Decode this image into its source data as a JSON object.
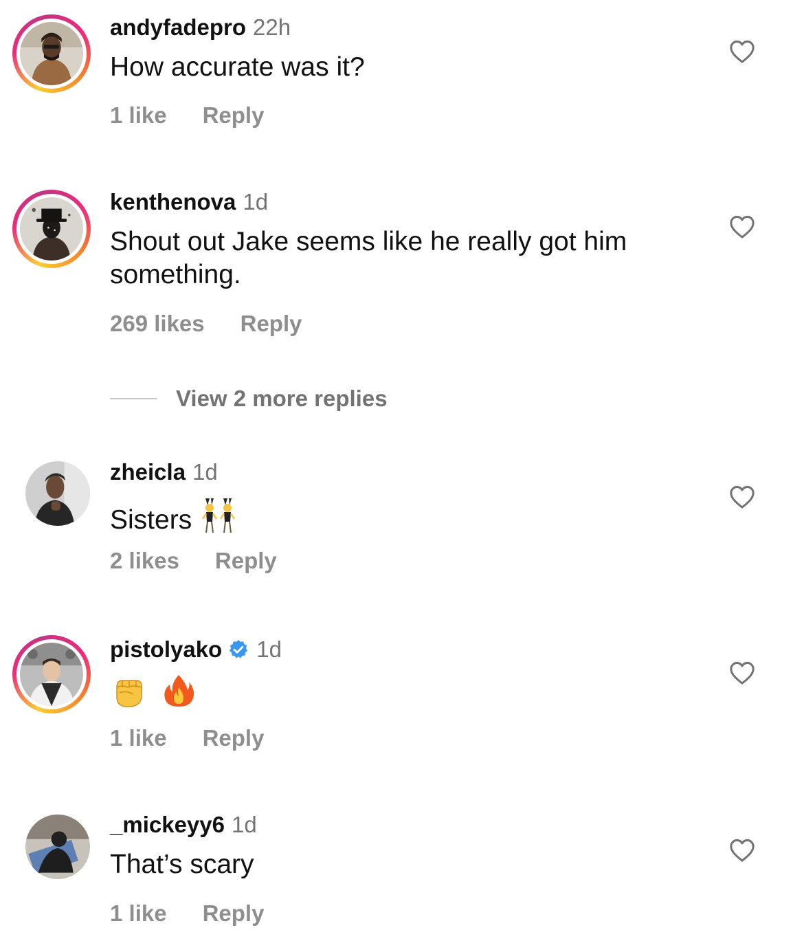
{
  "comments": [
    {
      "username": "andyfadepro",
      "time": "22h",
      "text": "How accurate was it?",
      "likes": "1 like",
      "reply": "Reply",
      "story_ring": true,
      "verified": false
    },
    {
      "username": "kenthenova",
      "time": "1d",
      "text": "Shout out Jake seems like he really got him something.",
      "likes": "269 likes",
      "reply": "Reply",
      "story_ring": true,
      "verified": false,
      "view_more_replies": "View 2 more replies"
    },
    {
      "username": "zheicla",
      "time": "1d",
      "text": "Sisters",
      "emoji": "women-with-bunny-ears-emoji",
      "likes": "2 likes",
      "reply": "Reply",
      "story_ring": false,
      "verified": false
    },
    {
      "username": "pistolyako",
      "time": "1d",
      "text": "",
      "emoji": [
        "raised-fist-emoji",
        "fire-emoji"
      ],
      "likes": "1 like",
      "reply": "Reply",
      "story_ring": true,
      "verified": true
    },
    {
      "username": "_mickeyy6",
      "time": "1d",
      "text": "That’s scary",
      "likes": "1 like",
      "reply": "Reply",
      "story_ring": false,
      "verified": false
    }
  ],
  "icons": {
    "like": "heart-outline-icon",
    "verified": "verified-badge-icon"
  },
  "colors": {
    "username": "#111111",
    "secondary_text": "#8e8e8e",
    "verified_badge": "#3897f0",
    "story_ring_start": "#f9ce34",
    "story_ring_mid": "#ee2a7b",
    "story_ring_end": "#c13584"
  }
}
